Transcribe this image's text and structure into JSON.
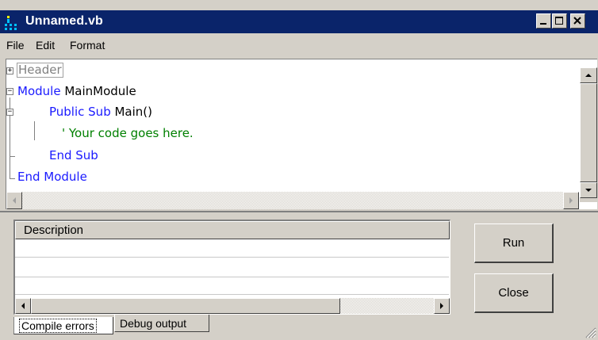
{
  "window": {
    "title": "Unnamed.vb"
  },
  "titlebar_buttons": [
    "minimize",
    "maximize",
    "close"
  ],
  "menu": {
    "items": [
      "File",
      "Edit",
      "Format"
    ]
  },
  "editor": {
    "header": "Header",
    "lines": [
      {
        "keyword": "Module",
        "text": " MainModule"
      },
      {
        "keyword": "Public Sub",
        "text": " Main()"
      },
      {
        "comment": "' Your code goes here."
      },
      {
        "keyword": "End Sub",
        "text": ""
      },
      {
        "keyword": "End Module",
        "text": ""
      }
    ]
  },
  "errors_panel": {
    "column_header": "Description",
    "rows": [
      "",
      "",
      ""
    ]
  },
  "tabs": [
    "Compile errors",
    "Debug output"
  ],
  "buttons": {
    "run": "Run",
    "close": "Close"
  },
  "colors": {
    "titlebar": "#0a246a",
    "keyword": "#1a1aff",
    "comment": "#008000",
    "face": "#d4d0c8"
  }
}
